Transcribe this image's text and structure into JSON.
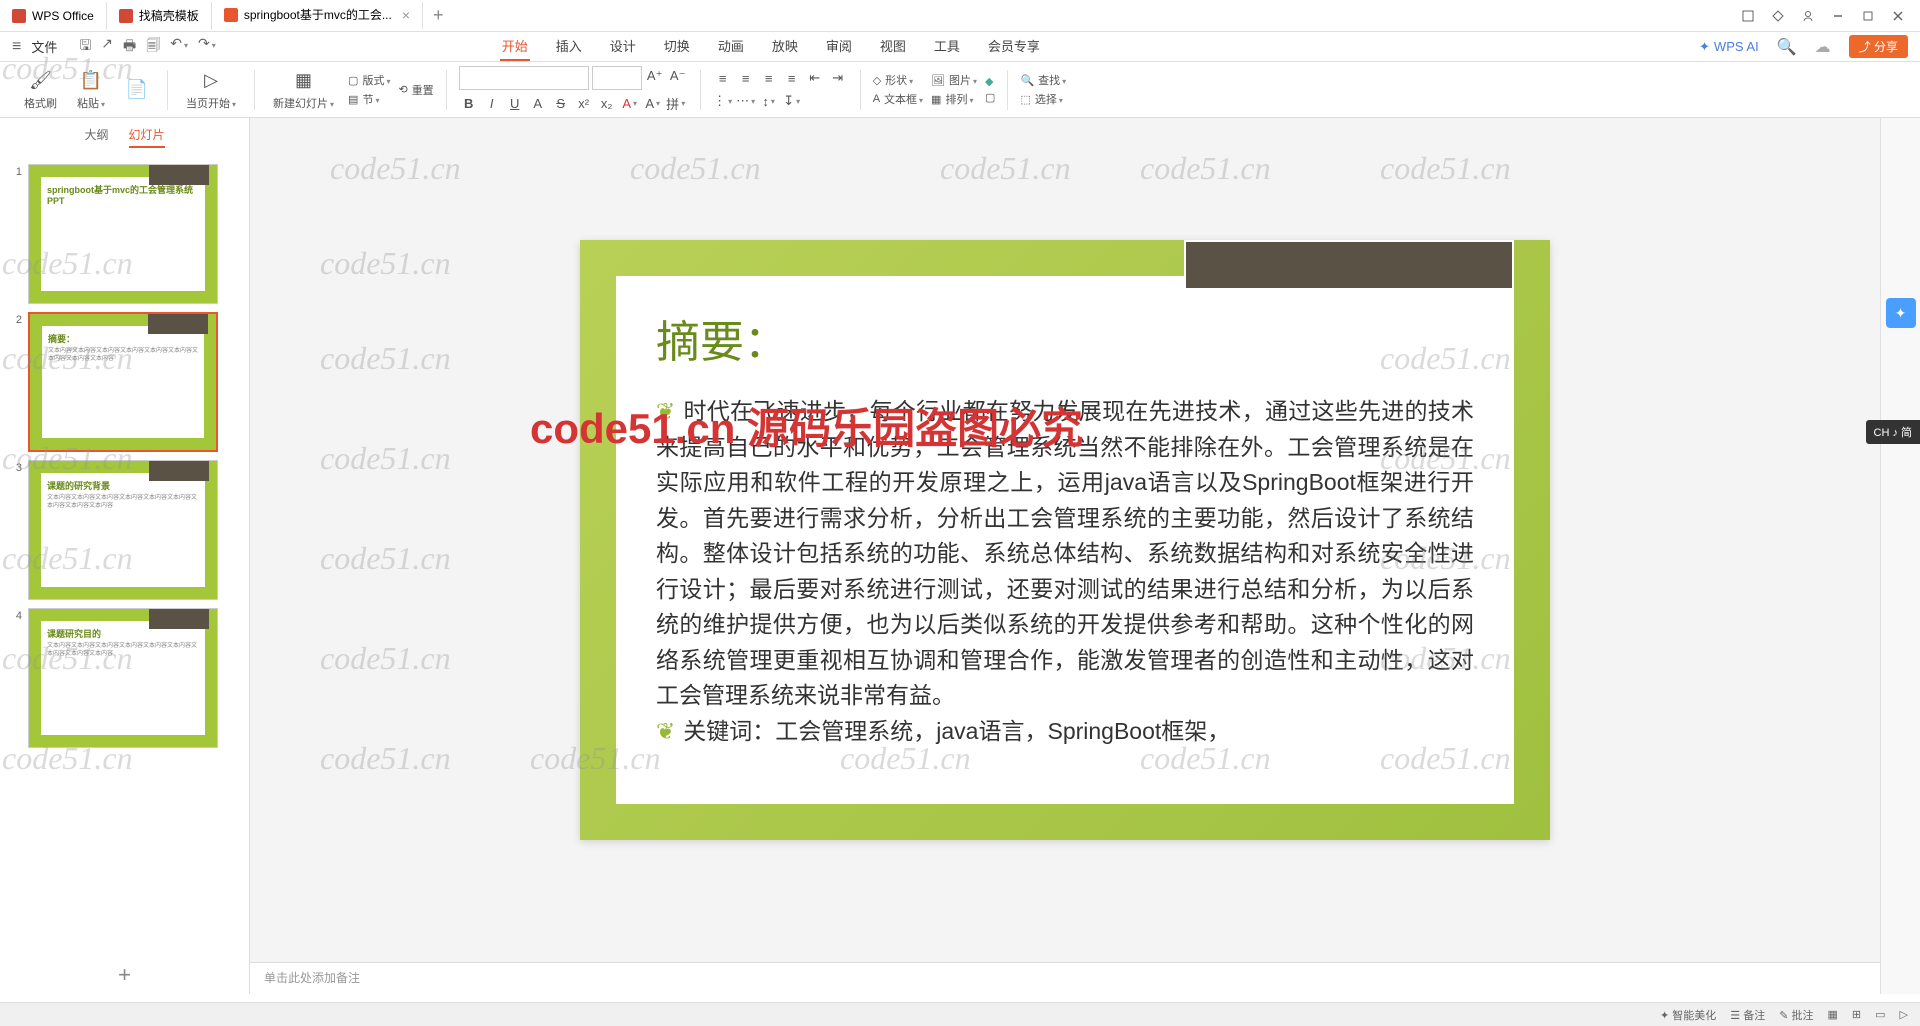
{
  "titlebar": {
    "tabs": [
      {
        "label": "WPS Office"
      },
      {
        "label": "找稿壳模板"
      },
      {
        "label": "springboot基于mvc的工会..."
      }
    ],
    "close": "×",
    "add": "+"
  },
  "menubar": {
    "file": "文件",
    "tabs": [
      "开始",
      "插入",
      "设计",
      "切换",
      "动画",
      "放映",
      "审阅",
      "视图",
      "工具",
      "会员专享"
    ],
    "ai": "WPS AI",
    "share": "分享"
  },
  "ribbon": {
    "format_painter": "格式刷",
    "paste": "粘贴",
    "from_beginning": "当页开始",
    "new_slide": "新建幻灯片",
    "layout": "版式",
    "section": "节",
    "reset": "重置",
    "shape": "形状",
    "picture": "图片",
    "textbox": "文本框",
    "arrange": "排列",
    "find": "查找",
    "select": "选择"
  },
  "sidepanel": {
    "outline": "大纲",
    "slides": "幻灯片",
    "thumbs": [
      {
        "num": "1",
        "title": "springboot基于mvc的工会管理系统PPT"
      },
      {
        "num": "2",
        "title": "摘要："
      },
      {
        "num": "3",
        "title": "课题的研究背景"
      },
      {
        "num": "4",
        "title": "课题研究目的"
      }
    ],
    "selected": 1
  },
  "slide": {
    "heading": "摘要：",
    "body1": "时代在飞速进步，每个行业都在努力发展现在先进技术，通过这些先进的技术来提高自己的水平和优势，工会管理系统当然不能排除在外。工会管理系统是在实际应用和软件工程的开发原理之上，运用java语言以及SpringBoot框架进行开发。首先要进行需求分析，分析出工会管理系统的主要功能，然后设计了系统结构。整体设计包括系统的功能、系统总体结构、系统数据结构和对系统安全性进行设计；最后要对系统进行测试，还要对测试的结果进行总结和分析，为以后系统的维护提供方便，也为以后类似系统的开发提供参考和帮助。这种个性化的网络系统管理更重视相互协调和管理合作，能激发管理者的创造性和主动性，这对工会管理系统来说非常有益。",
    "body2": "关键词：工会管理系统，java语言，SpringBoot框架，"
  },
  "notes": "单击此处添加备注",
  "watermark": "code51.cn",
  "watermark_red": "code51.cn 源码乐园盗图必究",
  "ime": "CH ♪ 简",
  "status": {
    "beautify": "智能美化",
    "notes_lbl": "备注",
    "comments": "批注"
  }
}
